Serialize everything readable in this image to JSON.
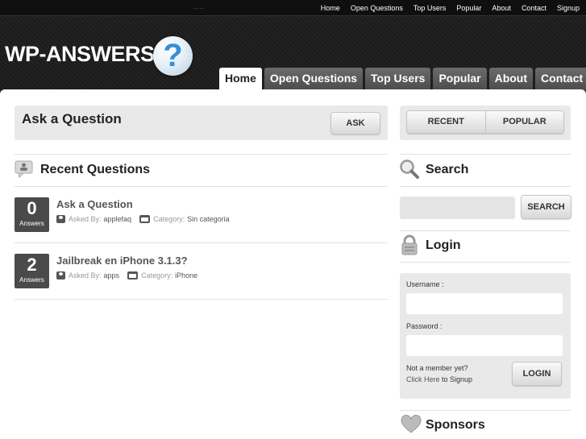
{
  "topbar": {
    "dots": "....",
    "links": [
      "Home",
      "Open Questions",
      "Top Users",
      "Popular",
      "About",
      "Contact",
      "Signup"
    ]
  },
  "logo": {
    "text": "WP-ANSWERS",
    "badge": "?"
  },
  "tabs": [
    "Home",
    "Open Questions",
    "Top Users",
    "Popular",
    "About",
    "Contact"
  ],
  "ask": {
    "title": "Ask a Question",
    "button": "ASK"
  },
  "sort": {
    "recent": "RECENT",
    "popular": "POPULAR"
  },
  "recent": {
    "title": "Recent Questions",
    "questions": [
      {
        "count": "0",
        "count_label": "Answers",
        "title": "Ask a Question",
        "asked_by_label": "Asked By:",
        "author": "applefaq",
        "category_label": "Category:",
        "category": "Sin categoria"
      },
      {
        "count": "2",
        "count_label": "Answers",
        "title": "Jailbreak en iPhone 3.1.3?",
        "asked_by_label": "Asked By:",
        "author": "apps",
        "category_label": "Category:",
        "category": "iPhone"
      }
    ]
  },
  "search": {
    "title": "Search",
    "button": "SEARCH",
    "value": ""
  },
  "login": {
    "title": "Login",
    "username_label": "Username :",
    "password_label": "Password :",
    "not_member": "Not a member yet?",
    "click_here": "Click Here",
    "to_signup": " to Signup",
    "button": "LOGIN"
  },
  "sponsors": {
    "title": "Sponsors"
  },
  "colors": {
    "header_bg": "#1e1e1e",
    "tab_active": "#ffffff",
    "tab_inactive": "#555555",
    "logo_badge": "#3a8fd0",
    "answer_box": "#4a4a4a"
  },
  "icons": [
    "question-mark-icon",
    "comment-icon",
    "search-icon",
    "lock-icon",
    "heart-icon",
    "user-icon",
    "folder-icon"
  ]
}
